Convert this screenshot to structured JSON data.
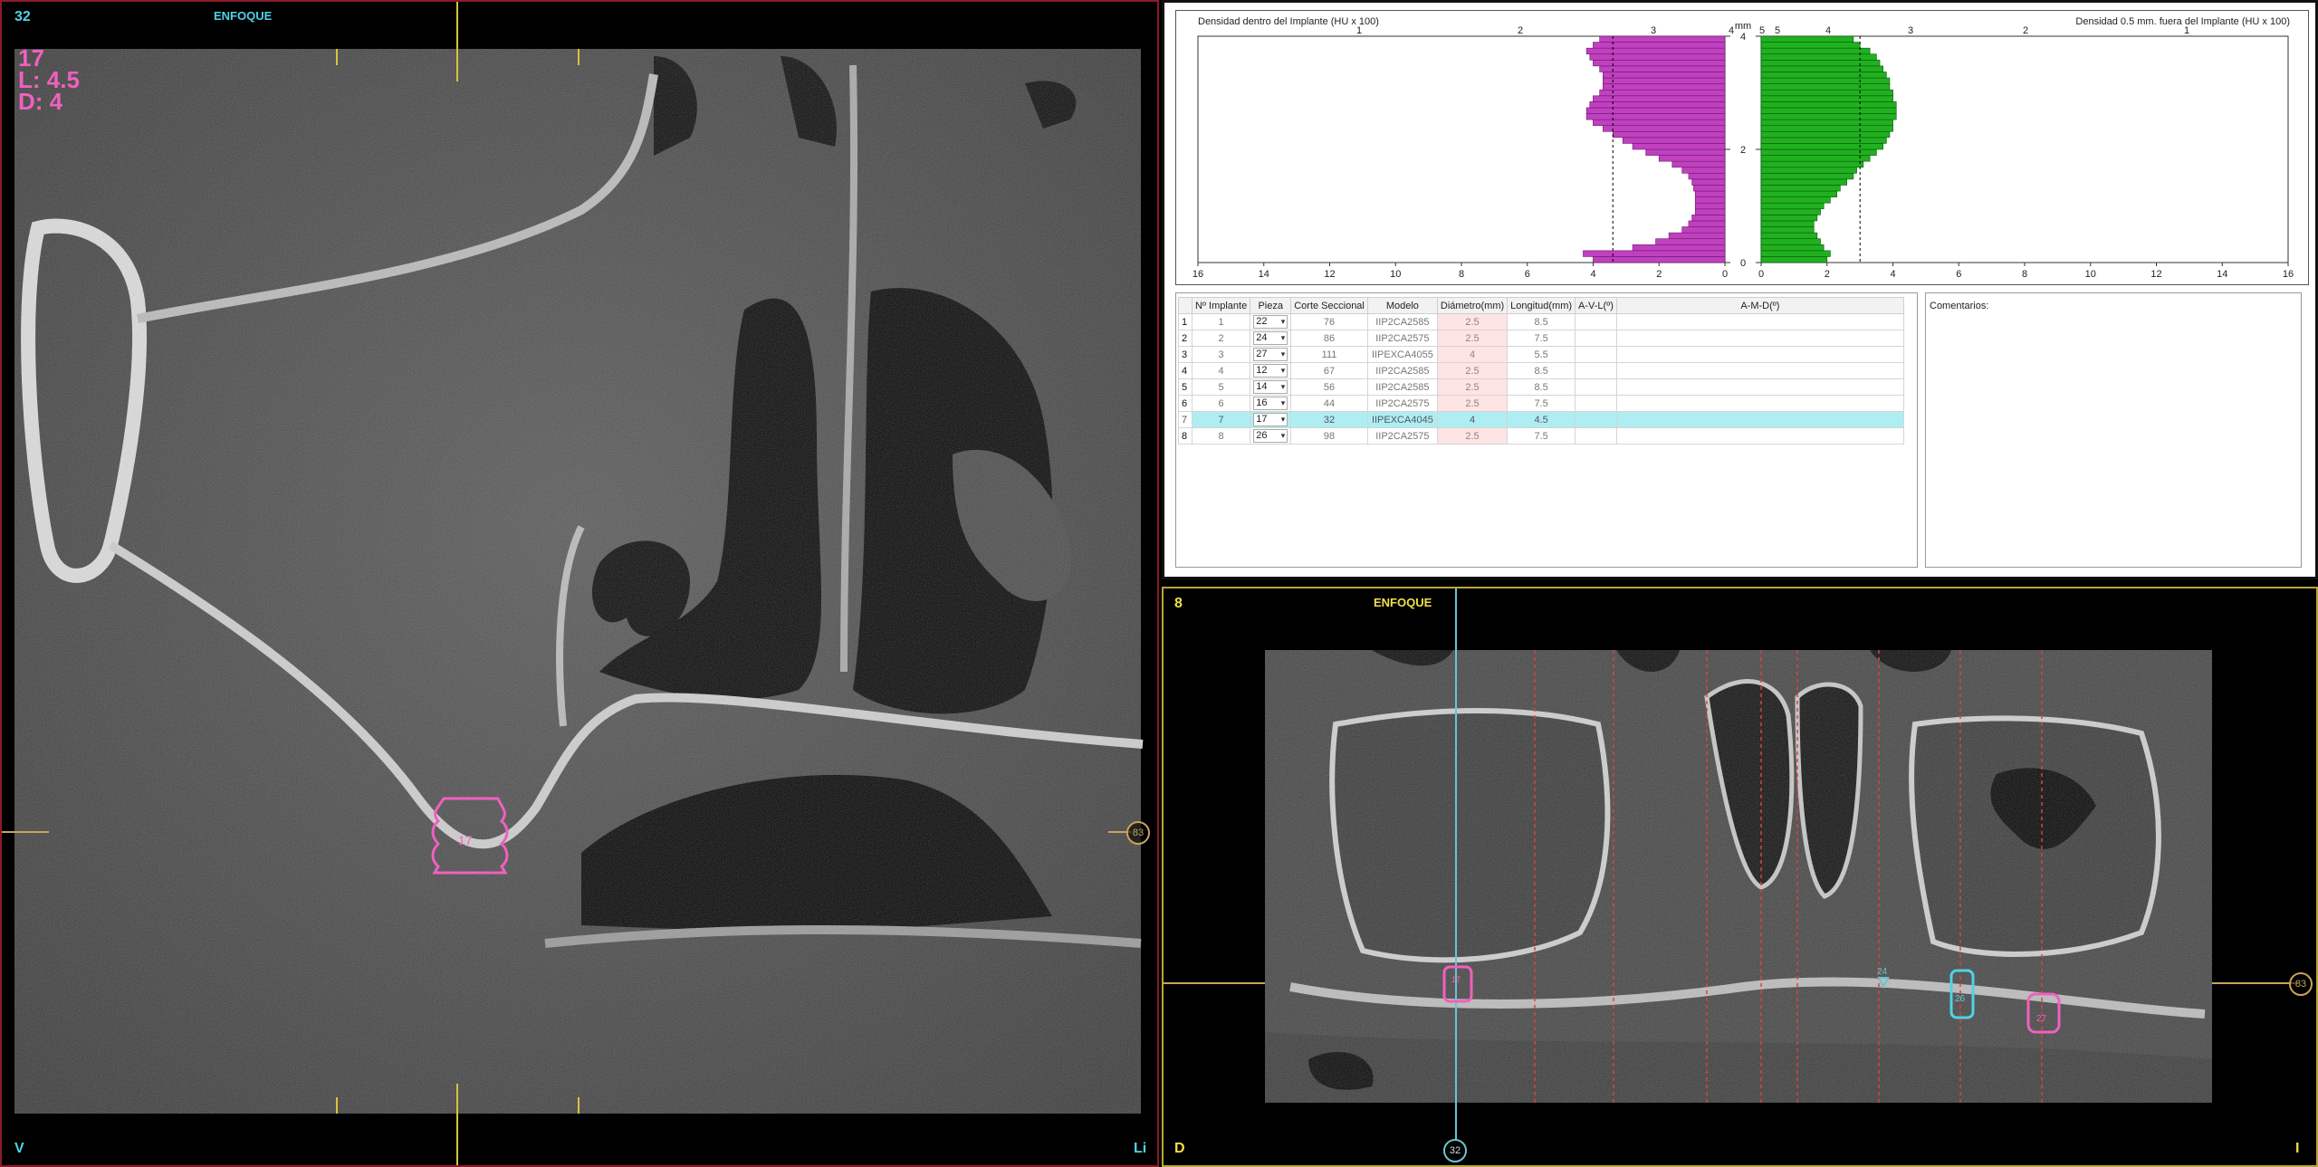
{
  "left_view": {
    "number": "32",
    "focus_label": "ENFOQUE",
    "implant_info": {
      "piece": "17",
      "length": "L: 4.5",
      "diameter": "D: 4"
    },
    "orientation_bottom_left": "V",
    "orientation_bottom_right": "Li",
    "implant_label": "17",
    "right_badge": "83"
  },
  "chart": {
    "left_title": "Densidad dentro del Implante (HU x 100)",
    "right_title": "Densidad 0.5 mm. fuera del Implante (HU x 100)",
    "center_unit": "mm",
    "center_ticks": [
      "4",
      "2",
      "0"
    ],
    "left_top_ticks": [
      "1",
      "2",
      "3",
      "4",
      "5"
    ],
    "right_top_ticks": [
      "5",
      "4",
      "3",
      "2",
      "1"
    ],
    "left_bottom_ticks": [
      "16",
      "14",
      "12",
      "10",
      "8",
      "6",
      "4",
      "2",
      "0"
    ],
    "right_bottom_ticks": [
      "0",
      "2",
      "4",
      "6",
      "8",
      "10",
      "12",
      "14",
      "16"
    ],
    "left_color": "#c040c0",
    "right_color": "#20b020"
  },
  "chart_data": [
    {
      "type": "bar",
      "title": "Densidad dentro del Implante (HU x 100)",
      "ylabel": "mm",
      "xlim": [
        0,
        16
      ],
      "ylim": [
        0,
        4
      ],
      "reference_line": 3.4,
      "values": [
        4.0,
        4.3,
        2.8,
        2.1,
        1.7,
        1.3,
        1.1,
        1.0,
        0.9,
        0.9,
        0.9,
        0.9,
        0.95,
        1.0,
        1.1,
        1.3,
        1.6,
        2.0,
        2.4,
        2.8,
        3.1,
        3.4,
        3.7,
        4.0,
        4.2,
        4.2,
        4.1,
        4.0,
        3.8,
        3.7,
        3.7,
        3.7,
        3.8,
        4.0,
        4.1,
        4.2,
        4.0,
        3.8
      ]
    },
    {
      "type": "bar",
      "title": "Densidad 0.5 mm. fuera del Implante (HU x 100)",
      "ylabel": "mm",
      "xlim": [
        0,
        16
      ],
      "ylim": [
        0,
        4
      ],
      "reference_line": 3.0,
      "values": [
        2.0,
        2.1,
        1.9,
        1.8,
        1.7,
        1.6,
        1.6,
        1.7,
        1.8,
        1.9,
        2.1,
        2.3,
        2.4,
        2.6,
        2.8,
        2.9,
        3.1,
        3.3,
        3.5,
        3.7,
        3.8,
        3.9,
        4.0,
        4.0,
        4.1,
        4.1,
        4.1,
        4.0,
        4.0,
        3.9,
        3.9,
        3.8,
        3.7,
        3.6,
        3.5,
        3.3,
        3.0,
        2.8
      ]
    }
  ],
  "table": {
    "headers": [
      "Nº Implante",
      "Pieza",
      "Corte Seccional",
      "Modelo",
      "Diámetro(mm)",
      "Longitud(mm)",
      "A-V-L(º)",
      "A-M-D(º)"
    ],
    "rows": [
      {
        "idx": "1",
        "implante": "1",
        "pieza": "22",
        "corte": "76",
        "modelo": "IIP2CA2585",
        "diametro": "2.5",
        "longitud": "8.5",
        "avl": "",
        "amd": ""
      },
      {
        "idx": "2",
        "implante": "2",
        "pieza": "24",
        "corte": "86",
        "modelo": "IIP2CA2575",
        "diametro": "2.5",
        "longitud": "7.5",
        "avl": "",
        "amd": ""
      },
      {
        "idx": "3",
        "implante": "3",
        "pieza": "27",
        "corte": "111",
        "modelo": "IIPEXCA4055",
        "diametro": "4",
        "longitud": "5.5",
        "avl": "",
        "amd": ""
      },
      {
        "idx": "4",
        "implante": "4",
        "pieza": "12",
        "corte": "67",
        "modelo": "IIP2CA2585",
        "diametro": "2.5",
        "longitud": "8.5",
        "avl": "",
        "amd": ""
      },
      {
        "idx": "5",
        "implante": "5",
        "pieza": "14",
        "corte": "56",
        "modelo": "IIP2CA2585",
        "diametro": "2.5",
        "longitud": "8.5",
        "avl": "",
        "amd": ""
      },
      {
        "idx": "6",
        "implante": "6",
        "pieza": "16",
        "corte": "44",
        "modelo": "IIP2CA2575",
        "diametro": "2.5",
        "longitud": "7.5",
        "avl": "",
        "amd": ""
      },
      {
        "idx": "7",
        "implante": "7",
        "pieza": "17",
        "corte": "32",
        "modelo": "IIPEXCA4045",
        "diametro": "4",
        "longitud": "4.5",
        "avl": "",
        "amd": "",
        "selected": true
      },
      {
        "idx": "8",
        "implante": "8",
        "pieza": "26",
        "corte": "98",
        "modelo": "IIP2CA2575",
        "diametro": "2.5",
        "longitud": "7.5",
        "avl": "",
        "amd": ""
      }
    ]
  },
  "comments": {
    "title": "Comentarios:"
  },
  "bottom_view": {
    "number": "8",
    "focus_label": "ENFOQUE",
    "orientation_bottom_left": "D",
    "orientation_bottom_right": "I",
    "bottom_badge": "32",
    "right_badge": "83",
    "implant_labels": [
      "17",
      "24",
      "26",
      "27"
    ]
  }
}
